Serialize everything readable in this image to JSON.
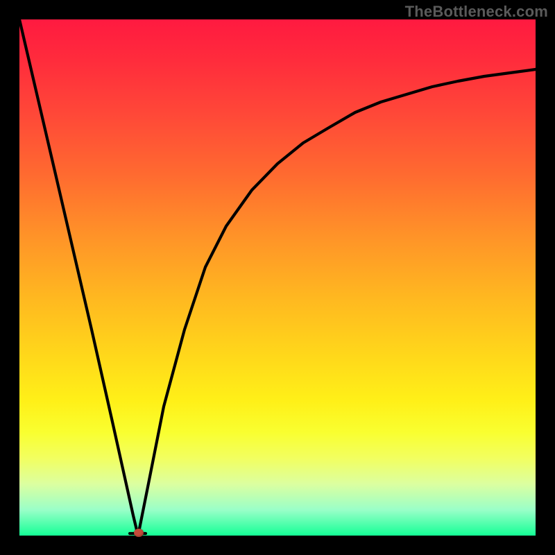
{
  "watermark": "TheBottleneck.com",
  "colors": {
    "frame": "#000000",
    "gradient_top": "#ff1a40",
    "gradient_mid": "#ffda1a",
    "gradient_bottom": "#14ff96",
    "curve": "#000000",
    "marker": "#c44b3a"
  },
  "chart_data": {
    "type": "line",
    "title": "",
    "xlabel": "",
    "ylabel": "",
    "xlim": [
      0,
      100
    ],
    "ylim": [
      0,
      100
    ],
    "grid": false,
    "legend": false,
    "series": [
      {
        "name": "bottleneck-left-branch",
        "x": [
          0,
          7,
          14,
          18,
          22,
          23
        ],
        "y": [
          100,
          70,
          40,
          22,
          4,
          0
        ]
      },
      {
        "name": "bottleneck-right-branch",
        "x": [
          23,
          25,
          28,
          32,
          36,
          40,
          45,
          50,
          55,
          60,
          65,
          70,
          75,
          80,
          85,
          90,
          95,
          100
        ],
        "y": [
          0,
          10,
          25,
          40,
          52,
          60,
          67,
          72,
          76,
          79,
          82,
          84,
          85.5,
          87,
          88,
          89,
          89.7,
          90.3
        ]
      }
    ],
    "annotations": [
      {
        "name": "optimal-point",
        "x": 23,
        "y": 0
      }
    ]
  }
}
